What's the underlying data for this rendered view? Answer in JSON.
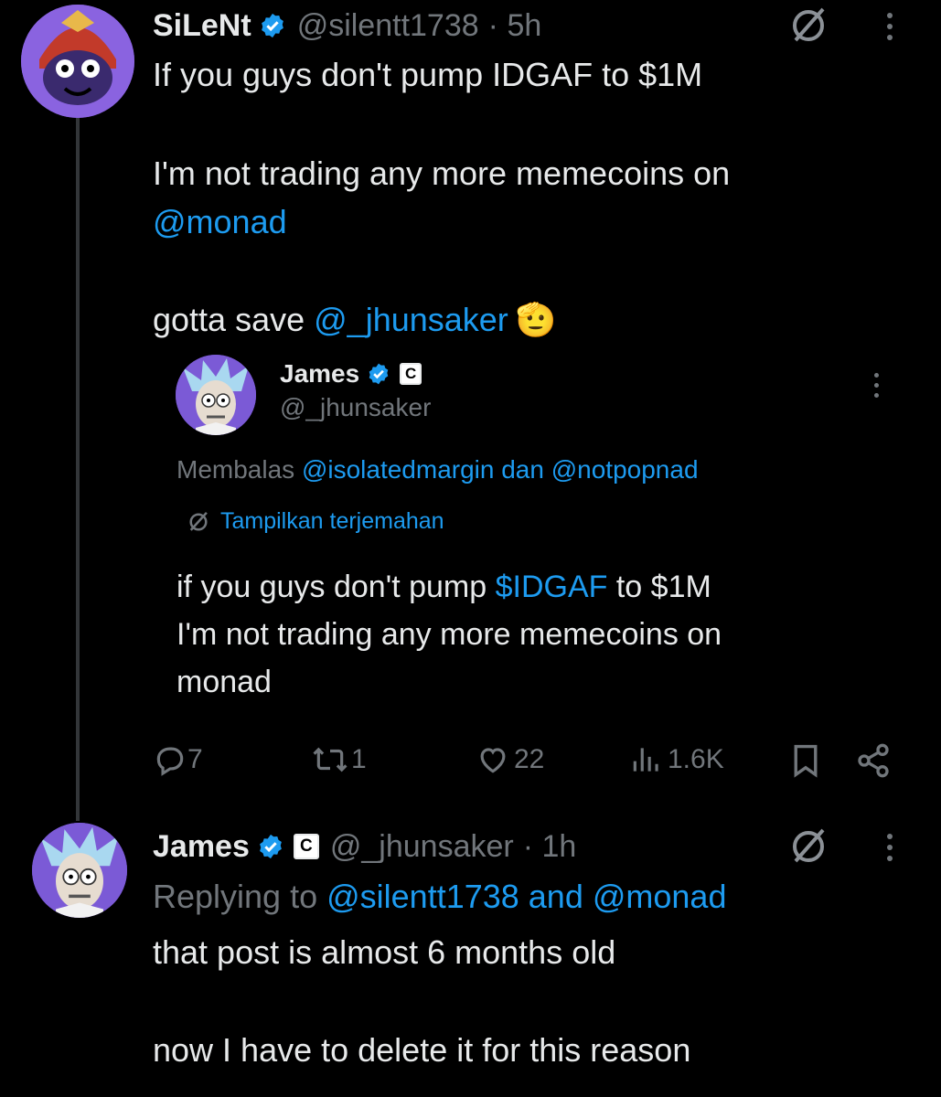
{
  "post1": {
    "author_name": "SiLeNt",
    "handle": "@silentt1738",
    "time": "· 5h",
    "line1": "If you guys don't pump IDGAF to $1M",
    "line2": "I'm not trading any more memecoins on",
    "mention_monad": "@monad",
    "line4_prefix": "gotta save ",
    "mention_jhunsaker": "@_jhunsaker",
    "emoji": "🫡"
  },
  "quote": {
    "author_name": "James",
    "badge": "C",
    "handle": "@_jhunsaker",
    "replying_prefix": "Membalas ",
    "replying_to": "@isolatedmargin dan @notpopnad",
    "translate_label": "Tampilkan terjemahan",
    "body_l1_a": "if you guys don't pump ",
    "body_l1_cashtag": "$IDGAF",
    "body_l1_b": " to $1M",
    "body_l2": "I'm not trading any more memecoins on",
    "body_l3": "monad"
  },
  "actions": {
    "replies": "7",
    "reposts": "1",
    "likes": "22",
    "views": "1.6K"
  },
  "post2": {
    "author_name": "James",
    "badge": "C",
    "handle": "@_jhunsaker",
    "time": "· 1h",
    "replying_prefix": "Replying to ",
    "replying_to": "@silentt1738 and @monad",
    "line1": "that post is almost 6 months old",
    "line2": "now I have to delete it for this reason"
  },
  "colors": {
    "background": "#000000",
    "text": "#e7e9ea",
    "muted": "#71767b",
    "accent": "#1d9bf0",
    "avatar_purple": "#6b4bc9"
  }
}
